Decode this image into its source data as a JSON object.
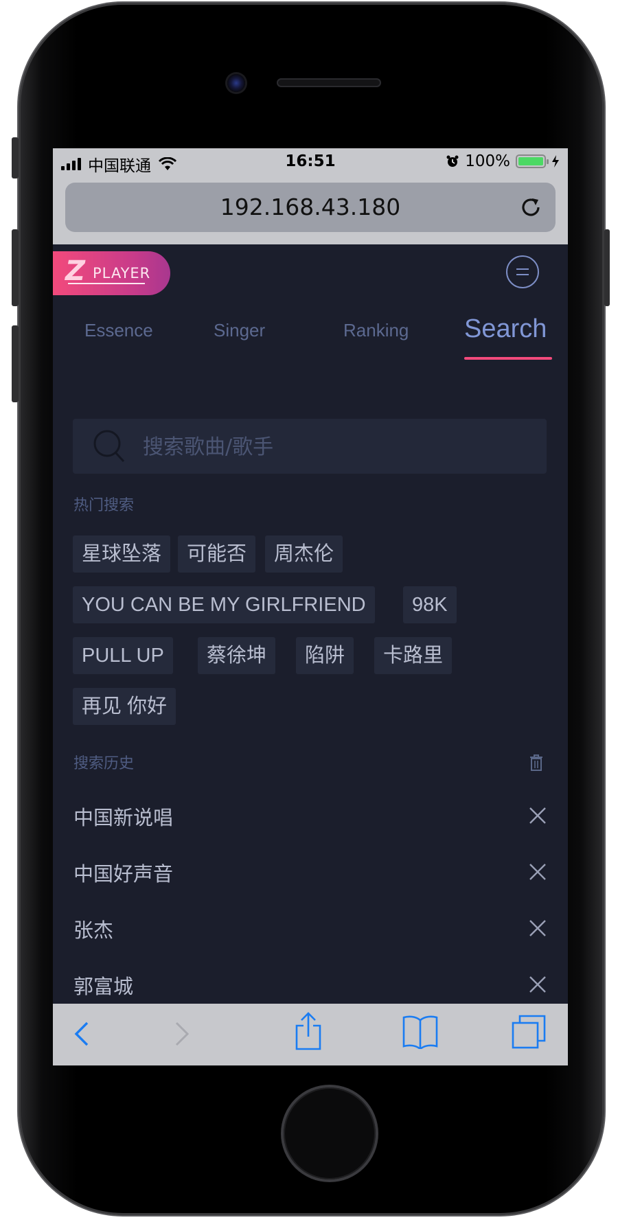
{
  "status_bar": {
    "carrier": "中国联通",
    "time": "16:51",
    "battery": "100%",
    "battery_level": 1.0
  },
  "browser": {
    "url": "192.168.43.180"
  },
  "app": {
    "logo_letter": "Z",
    "logo_text": "PLAYER"
  },
  "tabs": [
    {
      "label": "Essence",
      "active": false
    },
    {
      "label": "Singer",
      "active": false
    },
    {
      "label": "Ranking",
      "active": false
    },
    {
      "label": "Search",
      "active": true
    }
  ],
  "search": {
    "placeholder": "搜索歌曲/歌手",
    "value": ""
  },
  "hot_search": {
    "title": "热门搜索",
    "tags": [
      "星球坠落",
      "可能否",
      "周杰伦",
      "YOU CAN BE MY GIRLFRIEND",
      "98K",
      "PULL UP",
      "蔡徐坤",
      "陷阱",
      "卡路里",
      "再见 你好"
    ]
  },
  "history": {
    "title": "搜索历史",
    "items": [
      "中国新说唱",
      "中国好声音",
      "张杰",
      "郭富城"
    ]
  },
  "colors": {
    "accent": "#f24a7c",
    "tab_active": "#8197d6",
    "background": "#1b1e2c"
  }
}
